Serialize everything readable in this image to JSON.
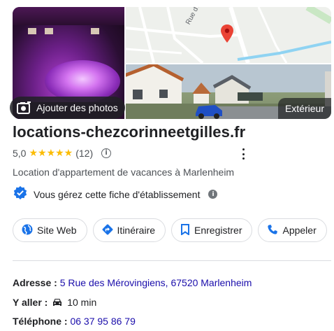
{
  "photos": {
    "add_photos_label": "Ajouter des photos",
    "exterior_label": "Extérieur",
    "map_road_label": "Rue d'Austrasie"
  },
  "business": {
    "name": "locations-chezcorinneetgilles.fr",
    "rating": "5,0",
    "stars": "★★★★★",
    "review_count": "(12)",
    "category": "Location d'appartement de vacances à Marlenheim",
    "verified_text": "Vous gérez cette fiche d'établissement"
  },
  "actions": {
    "website": "Site Web",
    "directions": "Itinéraire",
    "save": "Enregistrer",
    "call": "Appeler"
  },
  "details": {
    "address_label": "Adresse :",
    "address_value": "5 Rue des Mérovingiens, 67520 Marlenheim",
    "travel_label": "Y aller :",
    "travel_value": "10 min",
    "phone_label": "Téléphone :",
    "phone_value": "06 37 95 86 79"
  },
  "colors": {
    "accent": "#1a73e8",
    "link": "#1a0dab",
    "star": "#fbbc04",
    "map_pin": "#ea4335"
  },
  "icons": [
    "add-photo-icon",
    "info-icon",
    "more-vert-icon",
    "verified-badge-icon",
    "globe-icon",
    "directions-icon",
    "bookmark-icon",
    "phone-icon",
    "car-icon",
    "map-pin-icon"
  ]
}
